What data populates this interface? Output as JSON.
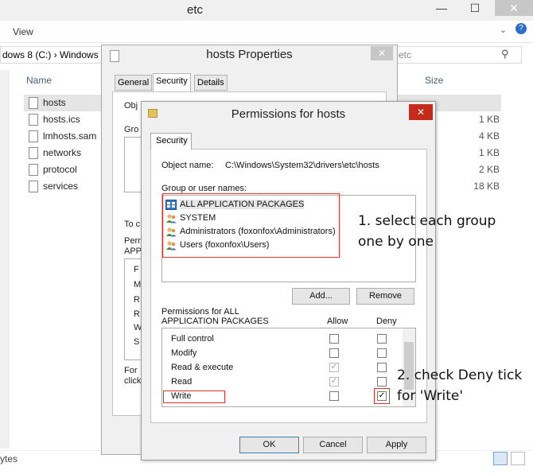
{
  "explorer": {
    "window_title": "etc",
    "minimize_glyph": "—",
    "maximize_glyph": "☐",
    "close_glyph": "✕",
    "ribbon_view": "View",
    "help_glyph": "?",
    "address": "dows 8 (C:)  ›  Windows",
    "search_placeholder": "etc",
    "col_name": "Name",
    "col_size": "Size",
    "files": [
      {
        "name": "hosts",
        "size": ""
      },
      {
        "name": "hosts.ics",
        "size": "1 KB"
      },
      {
        "name": "lmhosts.sam",
        "size": "4 KB"
      },
      {
        "name": "networks",
        "size": "1 KB"
      },
      {
        "name": "protocol",
        "size": "2 KB"
      },
      {
        "name": "services",
        "size": "18 KB"
      }
    ],
    "status_text": "ytes"
  },
  "properties": {
    "title": "hosts Properties",
    "close_glyph": "✕",
    "tabs": [
      "General",
      "Security",
      "Details"
    ],
    "fragments": [
      "Obj",
      "Gro",
      "To c",
      "Perm",
      "APP",
      "F",
      "M",
      "R",
      "R",
      "W",
      "S",
      "For",
      "click"
    ]
  },
  "permissions": {
    "title": "Permissions for hosts",
    "close_glyph": "✕",
    "tab": "Security",
    "object_name_label": "Object name:",
    "object_name_value": "C:\\Windows\\System32\\drivers\\etc\\hosts",
    "groups_label": "Group or user names:",
    "groups": [
      "ALL APPLICATION PACKAGES",
      "SYSTEM",
      "Administrators (foxonfox\\Administrators)",
      "Users (foxonfox\\Users)"
    ],
    "add_button": "Add...",
    "remove_button": "Remove",
    "perms_label_line1": "Permissions for ALL",
    "perms_label_line2": "APPLICATION PACKAGES",
    "allow_header": "Allow",
    "deny_header": "Deny",
    "rows": [
      {
        "name": "Full control",
        "allow": "",
        "deny": ""
      },
      {
        "name": "Modify",
        "allow": "",
        "deny": ""
      },
      {
        "name": "Read & execute",
        "allow": "✓",
        "deny": ""
      },
      {
        "name": "Read",
        "allow": "✓",
        "deny": ""
      },
      {
        "name": "Write",
        "allow": "",
        "deny": "✓"
      }
    ],
    "ok_button": "OK",
    "cancel_button": "Cancel",
    "apply_button": "Apply"
  },
  "annotations": {
    "note1_line1": "1. select each group",
    "note1_line2": "one by one",
    "note2_line1": "2. check Deny tick",
    "note2_line2": "for 'Write'"
  },
  "colors": {
    "annotation_red": "#e0312b",
    "close_red": "#c42b1c",
    "folder": "#e4c35e"
  }
}
